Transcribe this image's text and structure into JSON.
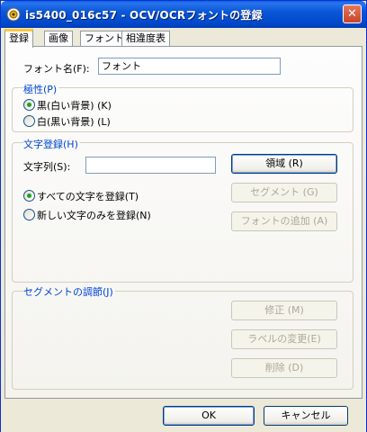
{
  "window": {
    "title": "is5400_016c57 - OCV/OCRフォントの登録",
    "close_glyph": "✕"
  },
  "tabs": [
    {
      "label": "登録",
      "active": true
    },
    {
      "label": "画像"
    },
    {
      "label": "フォント"
    },
    {
      "label": "相違度表"
    }
  ],
  "font_name": {
    "label": "フォント名(F):",
    "value": "フォント"
  },
  "polarity": {
    "title": "極性(P)",
    "options": [
      {
        "label": "黒(白い背景) (K)",
        "selected": true
      },
      {
        "label": "白(黒い背景) (L)",
        "selected": false
      }
    ]
  },
  "char_register": {
    "title": "文字登録(H)",
    "string_label": "文字列(S):",
    "string_value": "",
    "region_button": "領域 (R)",
    "segment_button": "セグメント (G)",
    "add_font_button": "フォントの追加 (A)",
    "options": [
      {
        "label": "すべての文字を登録(T)",
        "selected": true
      },
      {
        "label": "新しい文字のみを登録(N)",
        "selected": false
      }
    ]
  },
  "segment_adjust": {
    "title": "セグメントの調節(J)",
    "modify_button": "修正 (M)",
    "label_change_button": "ラベルの変更(E)",
    "delete_button": "削除 (D)"
  },
  "footer": {
    "ok": "OK",
    "cancel": "キャンセル"
  },
  "colors": {
    "titlebar": "#0a57d8",
    "group_title": "#0046d5",
    "radio_dot": "#21a121",
    "window_bg": "#ece9d8"
  }
}
